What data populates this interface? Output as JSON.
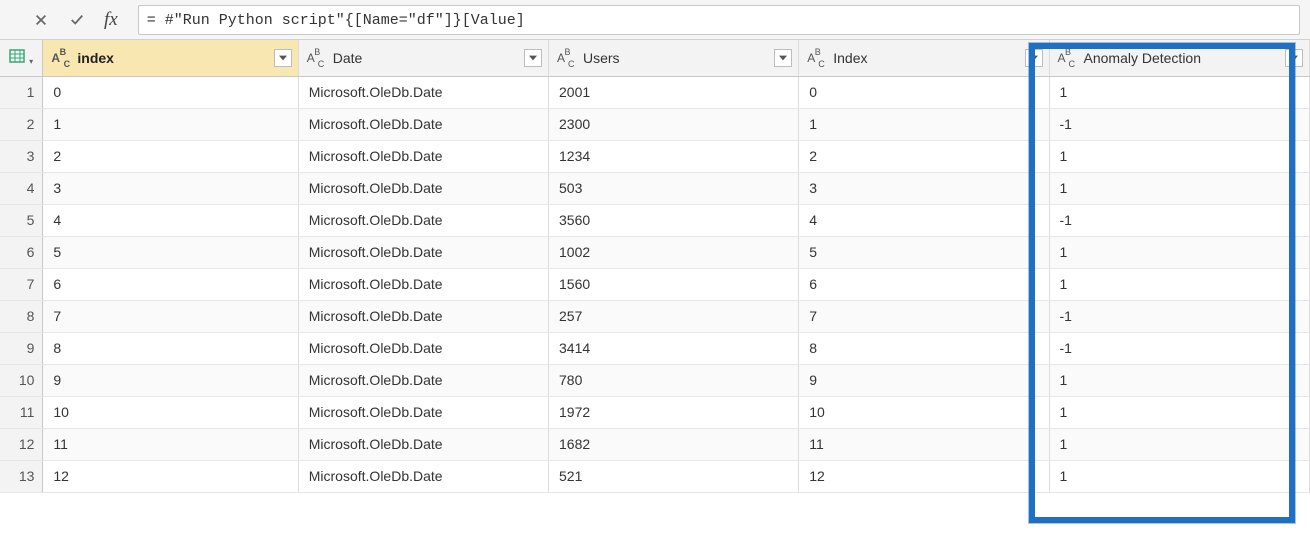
{
  "formula_bar": {
    "fx_label": "fx",
    "expression": "= #\"Run Python script\"{[Name=\"df\"]}[Value]"
  },
  "columns": [
    {
      "name": "index",
      "type_label": "ABC",
      "selected": true
    },
    {
      "name": "Date",
      "type_label": "ABC",
      "selected": false
    },
    {
      "name": "Users",
      "type_label": "ABC",
      "selected": false
    },
    {
      "name": "Index",
      "type_label": "ABC",
      "selected": false
    },
    {
      "name": "Anomaly Detection",
      "type_label": "ABC",
      "selected": false,
      "highlighted": true
    }
  ],
  "rows": [
    {
      "n": "1",
      "index": "0",
      "date": "Microsoft.OleDb.Date",
      "users": "2001",
      "Index": "0",
      "anomaly": "1"
    },
    {
      "n": "2",
      "index": "1",
      "date": "Microsoft.OleDb.Date",
      "users": "2300",
      "Index": "1",
      "anomaly": "-1"
    },
    {
      "n": "3",
      "index": "2",
      "date": "Microsoft.OleDb.Date",
      "users": "1234",
      "Index": "2",
      "anomaly": "1"
    },
    {
      "n": "4",
      "index": "3",
      "date": "Microsoft.OleDb.Date",
      "users": "503",
      "Index": "3",
      "anomaly": "1"
    },
    {
      "n": "5",
      "index": "4",
      "date": "Microsoft.OleDb.Date",
      "users": "3560",
      "Index": "4",
      "anomaly": "-1"
    },
    {
      "n": "6",
      "index": "5",
      "date": "Microsoft.OleDb.Date",
      "users": "1002",
      "Index": "5",
      "anomaly": "1"
    },
    {
      "n": "7",
      "index": "6",
      "date": "Microsoft.OleDb.Date",
      "users": "1560",
      "Index": "6",
      "anomaly": "1"
    },
    {
      "n": "8",
      "index": "7",
      "date": "Microsoft.OleDb.Date",
      "users": "257",
      "Index": "7",
      "anomaly": "-1"
    },
    {
      "n": "9",
      "index": "8",
      "date": "Microsoft.OleDb.Date",
      "users": "3414",
      "Index": "8",
      "anomaly": "-1"
    },
    {
      "n": "10",
      "index": "9",
      "date": "Microsoft.OleDb.Date",
      "users": "780",
      "Index": "9",
      "anomaly": "1"
    },
    {
      "n": "11",
      "index": "10",
      "date": "Microsoft.OleDb.Date",
      "users": "1972",
      "Index": "10",
      "anomaly": "1"
    },
    {
      "n": "12",
      "index": "11",
      "date": "Microsoft.OleDb.Date",
      "users": "1682",
      "Index": "11",
      "anomaly": "1"
    },
    {
      "n": "13",
      "index": "12",
      "date": "Microsoft.OleDb.Date",
      "users": "521",
      "Index": "12",
      "anomaly": "1"
    }
  ]
}
